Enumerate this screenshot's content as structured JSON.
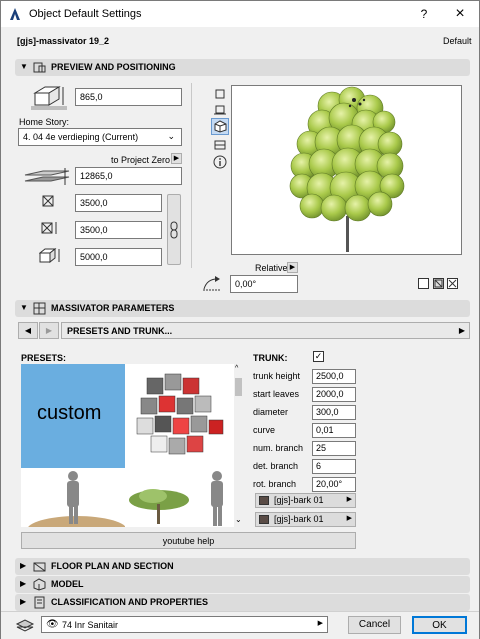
{
  "window": {
    "title": "Object Default Settings",
    "help": "?",
    "close": "×"
  },
  "header": {
    "object_name": "[gjs]-massivator 19_2",
    "default_label": "Default"
  },
  "sections": {
    "preview": "PREVIEW AND POSITIONING",
    "massivator": "MASSIVATOR PARAMETERS",
    "floor_plan": "FLOOR PLAN AND SECTION",
    "model": "MODEL",
    "classification": "CLASSIFICATION AND PROPERTIES"
  },
  "positioning": {
    "elevation": "865,0",
    "home_story_label": "Home Story:",
    "home_story_value": "4. 04 4e verdieping (Current)",
    "to_project_zero": "to Project Zero",
    "project_zero_value": "12865,0",
    "x_size": "3500,0",
    "y_size": "3500,0",
    "z_size": "5000,0",
    "relative_label": "Relative",
    "angle": "0,00°"
  },
  "params_nav": {
    "page_label": "PRESETS AND TRUNK..."
  },
  "presets": {
    "label": "PRESETS:",
    "custom_label": "custom",
    "youtube_button": "youtube help"
  },
  "trunk": {
    "label": "TRUNK:",
    "checked": true,
    "rows": [
      {
        "label": "trunk height",
        "value": "2500,0"
      },
      {
        "label": "start leaves",
        "value": "2000,0"
      },
      {
        "label": "diameter",
        "value": "300,0"
      },
      {
        "label": "curve",
        "value": "0,01"
      },
      {
        "label": "num. branch",
        "value": "25"
      },
      {
        "label": "det. branch",
        "value": "6"
      },
      {
        "label": "rot. branch",
        "value": "20,00°"
      }
    ],
    "materials": [
      "[gjs]-bark 01",
      "[gjs]-bark 01"
    ]
  },
  "footer": {
    "layer": "74 Inr Sanitair",
    "cancel": "Cancel",
    "ok": "OK"
  },
  "colors": {
    "tree_green": "#a9c94a",
    "tree_shadow": "#6f8f2c",
    "custom_tile": "#6aaee0"
  }
}
